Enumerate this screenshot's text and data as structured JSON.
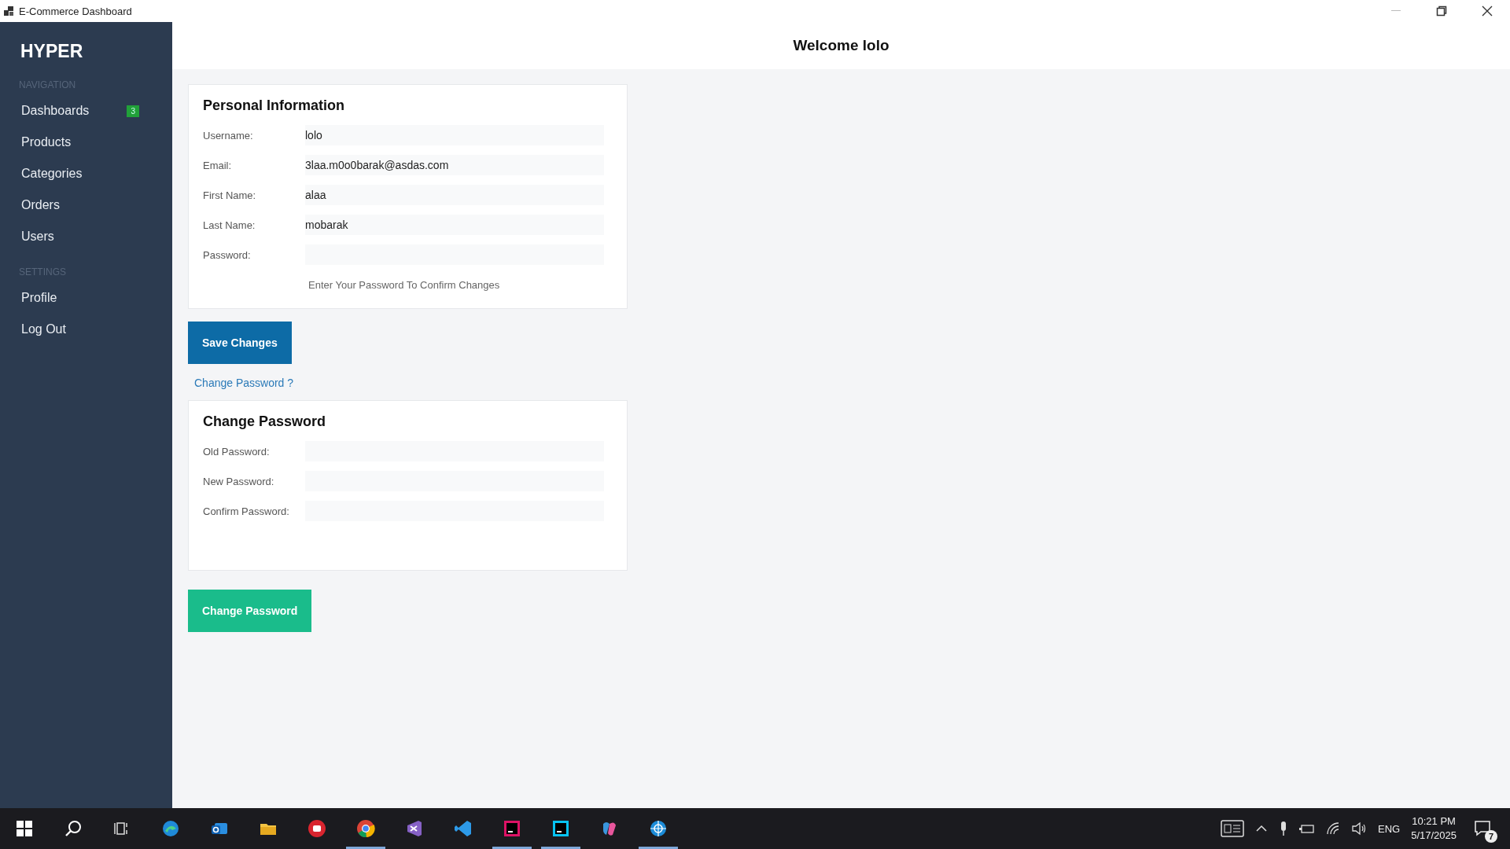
{
  "window": {
    "title": "E-Commerce Dashboard"
  },
  "sidebar": {
    "brand": "HYPER",
    "sections": [
      {
        "title": "NAVIGATION",
        "items": [
          {
            "label": "Dashboards",
            "badge": "3"
          },
          {
            "label": "Products"
          },
          {
            "label": "Categories"
          },
          {
            "label": "Orders"
          },
          {
            "label": "Users"
          }
        ]
      },
      {
        "title": "SETTINGS",
        "items": [
          {
            "label": "Profile"
          },
          {
            "label": "Log Out"
          }
        ]
      }
    ]
  },
  "header": {
    "title": "Welcome lolo"
  },
  "personal_info": {
    "title": "Personal Information",
    "fields": [
      {
        "label": "Username:",
        "value": "lolo"
      },
      {
        "label": "Email:",
        "value": "3laa.m0o0barak@asdas.com"
      },
      {
        "label": "First Name:",
        "value": "alaa"
      },
      {
        "label": "Last Name:",
        "value": "mobarak"
      },
      {
        "label": "Password:"
      }
    ],
    "hint": "Enter Your Password To Confirm Changes",
    "button": "Save Changes",
    "link": "Change Password ?"
  },
  "change_password": {
    "title": "Change Password",
    "fields": [
      {
        "label": "Old Password:"
      },
      {
        "label": "New Password:"
      },
      {
        "label": "Confirm Password:"
      }
    ],
    "button": "Change Password"
  },
  "taskbar": {
    "apps": [
      {
        "kind": "edge",
        "open": false
      },
      {
        "kind": "outlook",
        "open": false
      },
      {
        "kind": "folder",
        "open": false
      },
      {
        "kind": "red",
        "open": false
      },
      {
        "kind": "chrome",
        "open": true
      },
      {
        "kind": "studio",
        "open": false
      },
      {
        "kind": "vscode",
        "open": false
      },
      {
        "kind": "rider",
        "open": true
      },
      {
        "kind": "webstorm",
        "open": true
      },
      {
        "kind": "copilot",
        "open": false
      },
      {
        "kind": "globe",
        "open": true
      }
    ],
    "language": "ENG",
    "time": "10:21 PM",
    "date": "5/17/2025",
    "notifications": "7"
  }
}
